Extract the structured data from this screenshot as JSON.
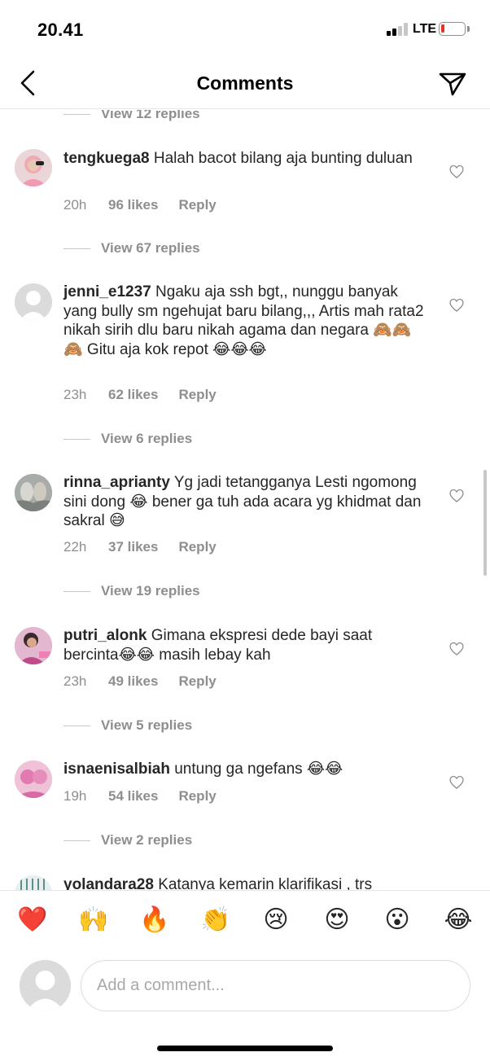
{
  "status_bar": {
    "time": "20.41",
    "network": "LTE"
  },
  "header": {
    "title": "Comments",
    "back_icon": "chevron-left-icon",
    "send_icon": "paper-plane-icon"
  },
  "comments": [
    {
      "user": "tengkuega8",
      "text": "Halah bacot bilang aja bunting duluan",
      "time": "20h",
      "likes": "96 likes",
      "reply": "Reply"
    },
    {
      "user": "jenni_e1237",
      "text": "Ngaku aja ssh bgt,, nunggu banyak yang bully sm ngehujat baru bilang,,, Artis mah rata2 nikah sirih dlu baru nikah agama dan negara 🙈🙈🙈 Gitu aja kok repot 😂😂😂",
      "time": "23h",
      "likes": "62 likes",
      "reply": "Reply"
    },
    {
      "user": "rinna_aprianty",
      "text": "Yg jadi tetangganya Lesti ngomong sini dong 😂 bener ga tuh ada acara yg khidmat dan sakral 😅",
      "time": "22h",
      "likes": "37 likes",
      "reply": "Reply"
    },
    {
      "user": "putri_alonk",
      "text": "Gimana ekspresi dede bayi saat bercinta😂😂 masih lebay kah",
      "time": "23h",
      "likes": "49 likes",
      "reply": "Reply"
    },
    {
      "user": "isnaenisalbiah",
      "text": "untung ga ngefans 😂😂",
      "time": "19h",
      "likes": "54 likes",
      "reply": "Reply"
    },
    {
      "user": "yolandara28",
      "text": "Katanya kemarin klarifikasi , trs",
      "time": "",
      "likes": "",
      "reply": ""
    }
  ],
  "view_replies": [
    "View 12 replies",
    "View 67 replies",
    "View 6 replies",
    "View 19 replies",
    "View 5 replies",
    "View 2 replies"
  ],
  "emoji_bar": [
    "❤️",
    "🙌",
    "🔥",
    "👏",
    "😢",
    "😍",
    "😮",
    "😂"
  ],
  "composer": {
    "placeholder": "Add a comment..."
  },
  "colors": {
    "text": "#262626",
    "muted": "#8e8e8e",
    "divider": "#e6e6e6",
    "battery_low": "#e6332a"
  }
}
